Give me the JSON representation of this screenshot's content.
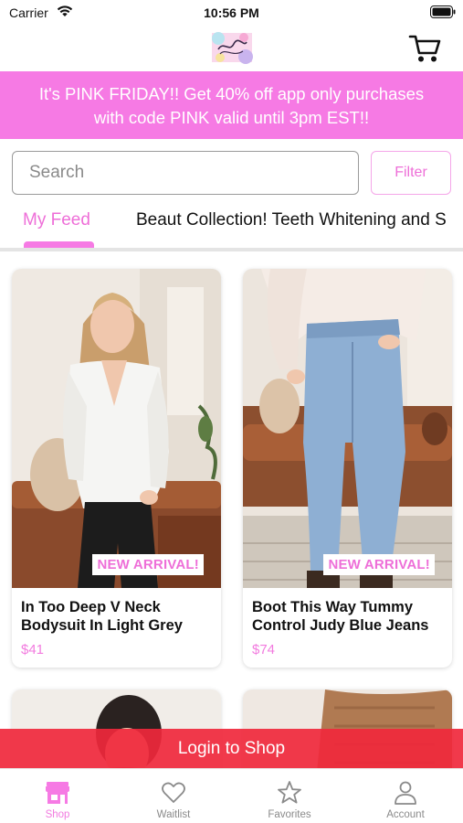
{
  "status_bar": {
    "carrier": "Carrier",
    "time": "10:56 PM"
  },
  "promo": {
    "line1": "It's PINK FRIDAY!! Get 40% off app only purchases",
    "line2": "with code PINK valid until 3pm EST!!"
  },
  "search": {
    "placeholder": "Search",
    "value": ""
  },
  "filter_label": "Filter",
  "tabs": [
    {
      "label": "My Feed",
      "active": true
    },
    {
      "label": "Beaut Collection! Teeth Whitening and S",
      "active": false
    }
  ],
  "products": [
    {
      "title": "In Too Deep V Neck Bodysuit In Light Grey",
      "price": "$41",
      "badge": "NEW ARRIVAL!"
    },
    {
      "title": "Boot This Way Tummy Control Judy Blue Jeans",
      "price": "$74",
      "badge": "NEW ARRIVAL!"
    }
  ],
  "login_label": "Login to Shop",
  "tab_bar": [
    {
      "label": "Shop",
      "icon": "storefront-icon",
      "active": true
    },
    {
      "label": "Waitlist",
      "icon": "heart-icon",
      "active": false
    },
    {
      "label": "Favorites",
      "icon": "star-icon",
      "active": false
    },
    {
      "label": "Account",
      "icon": "person-icon",
      "active": false
    }
  ],
  "colors": {
    "accent_pink": "#f67ae4",
    "login_red": "#f0283c",
    "price_pink": "#f27bdf"
  }
}
